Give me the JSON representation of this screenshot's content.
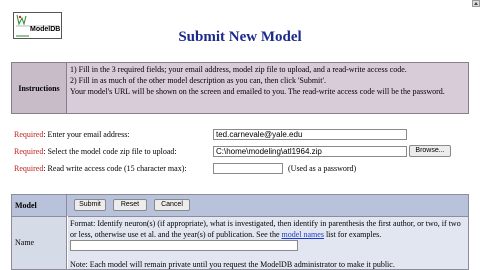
{
  "logo": {
    "text": "ModelDB"
  },
  "title": "Submit New Model",
  "instructions": {
    "label": "Instructions",
    "lines": [
      "1) Fill in the 3 required fields; your email address, model zip file to upload, and a read-write access code.",
      "2) Fill in as much of the other model description as you can, then click 'Submit'.",
      "Your model's URL will be shown on the screen and emailed to you. The read-write access code will be the password."
    ]
  },
  "required": {
    "marker": "Required",
    "email": {
      "label": ": Enter your email address:",
      "value": "ted.carnevale@yale.edu"
    },
    "zip": {
      "label": ": Select the model code zip file to upload:",
      "value": "C:\\home\\modeling\\atl1964.zip",
      "browse_label": "Browse..."
    },
    "access": {
      "label": ": Read write access code (15 character max):",
      "value": "",
      "note": "(Used as a password)"
    }
  },
  "model": {
    "label": "Model",
    "buttons": {
      "submit": "Submit",
      "reset": "Reset",
      "cancel": "Cancel"
    },
    "name": {
      "label": "Name",
      "format_before": "Format: Identify neuron(s) (if appropriate), what is investigated, then identify in parenthesis the first author, or two, if two or less, otherwise use et al. and the year(s) of publication. See the",
      "link": "model names",
      "format_after": "list for examples.",
      "value": "",
      "note": "Note: Each model will remain private until you request the ModelDB administrator to make it public."
    }
  }
}
